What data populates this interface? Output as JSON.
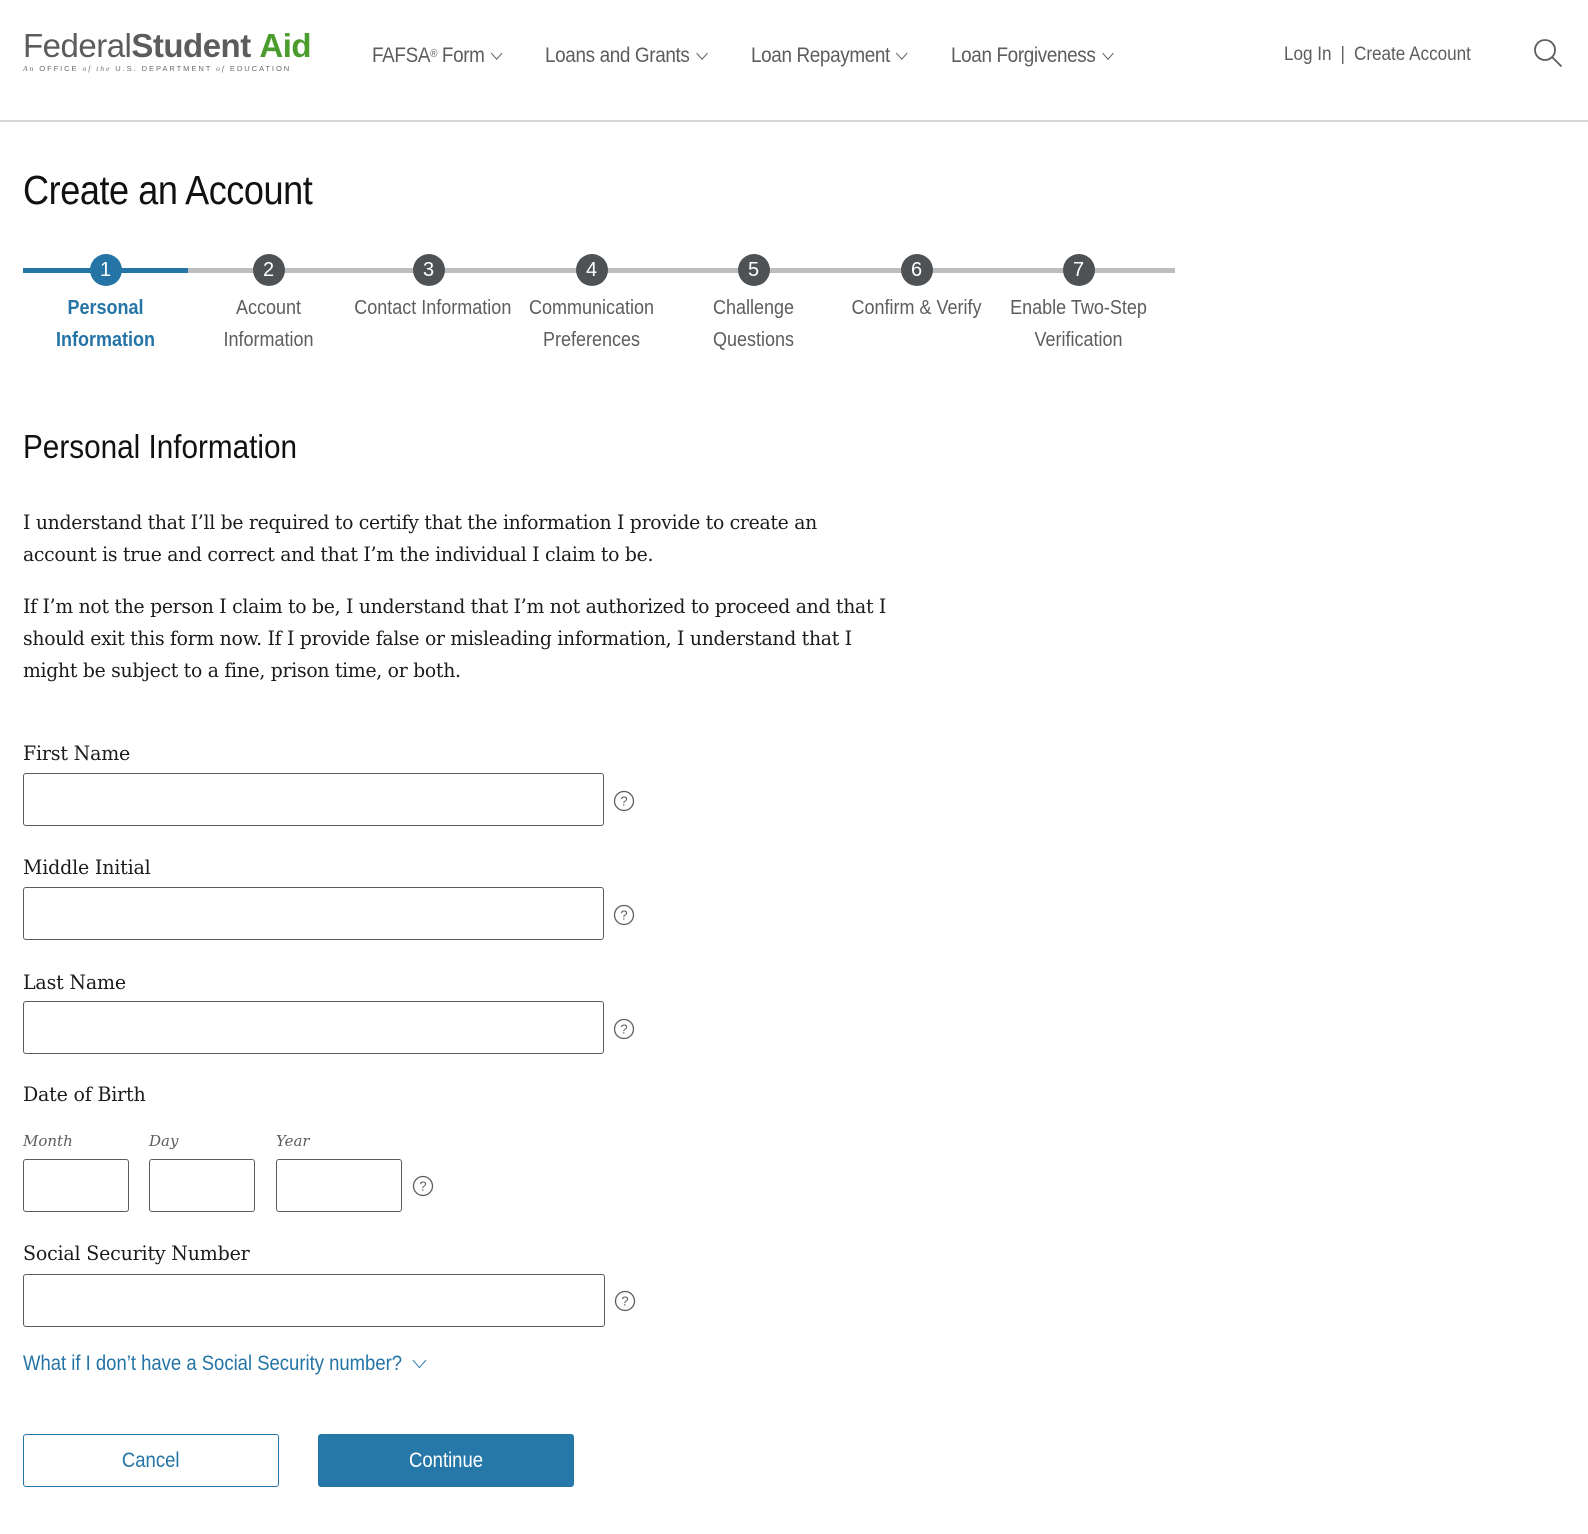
{
  "header": {
    "logo": {
      "federal": "Federal",
      "student": "Student",
      "aid": "Aid",
      "tagline_parts": [
        "An",
        "OFFICE",
        "of",
        "the",
        "U.S. DEPARTMENT",
        "of",
        "EDUCATION"
      ]
    },
    "nav": [
      {
        "label": "FAFSA",
        "sup": "®",
        "suffix": " Form",
        "icon": "chevron-down-icon"
      },
      {
        "label": "Loans and Grants",
        "icon": "chevron-down-icon"
      },
      {
        "label": "Loan Repayment",
        "icon": "chevron-down-icon"
      },
      {
        "label": "Loan Forgiveness",
        "icon": "chevron-down-icon"
      }
    ],
    "auth": {
      "login": "Log In",
      "separator": "|",
      "create_account": "Create Account"
    },
    "search_icon": "search-icon"
  },
  "page": {
    "title": "Create an Account"
  },
  "stepper": {
    "current_step": 1,
    "steps": [
      {
        "number": "1",
        "label_line1": "Personal",
        "label_line2": "Information",
        "active": true
      },
      {
        "number": "2",
        "label_line1": "Account",
        "label_line2": "Information",
        "active": false
      },
      {
        "number": "3",
        "label_line1": "Contact Information",
        "label_line2": "",
        "active": false
      },
      {
        "number": "4",
        "label_line1": "Communication",
        "label_line2": "Preferences",
        "active": false
      },
      {
        "number": "5",
        "label_line1": "Challenge",
        "label_line2": "Questions",
        "active": false
      },
      {
        "number": "6",
        "label_line1": "Confirm & Verify",
        "label_line2": "",
        "active": false
      },
      {
        "number": "7",
        "label_line1": "Enable Two-Step",
        "label_line2": "Verification",
        "active": false
      }
    ]
  },
  "section": {
    "title": "Personal Information",
    "paragraphs": [
      "I understand that I’ll be required to certify that the information I provide to create an account is true and correct and that I’m the individual I claim to be.",
      "If I’m not the person I claim to be, I understand that I’m not authorized to proceed and that I should exit this form now. If I provide false or misleading information, I understand that I might be subject to a fine, prison time, or both."
    ]
  },
  "form": {
    "first_name": {
      "label": "First Name",
      "value": "",
      "placeholder": ""
    },
    "middle_initial": {
      "label": "Middle Initial",
      "value": "",
      "placeholder": ""
    },
    "last_name": {
      "label": "Last Name",
      "value": "",
      "placeholder": ""
    },
    "dob": {
      "label": "Date of Birth",
      "month": {
        "label": "Month",
        "value": ""
      },
      "day": {
        "label": "Day",
        "value": ""
      },
      "year": {
        "label": "Year",
        "value": ""
      }
    },
    "ssn": {
      "label": "Social Security Number",
      "value": "",
      "placeholder": ""
    },
    "ssn_help_link": "What if I don’t have a Social Security number?",
    "help_icon": "question-circle-icon"
  },
  "buttons": {
    "cancel": "Cancel",
    "continue": "Continue"
  },
  "colors": {
    "accent_blue": "#2474a5",
    "logo_green": "#4a9c2d",
    "logo_gray": "#5b5c5e",
    "step_inactive": "#4f5254",
    "track_gray": "#bdbdbd"
  }
}
